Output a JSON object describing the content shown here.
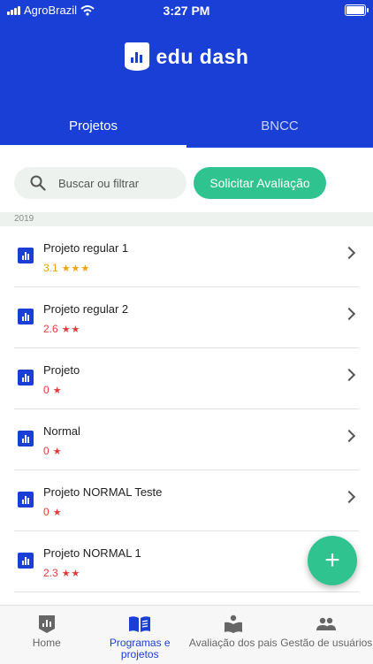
{
  "status_bar": {
    "carrier": "AgroBrazil",
    "time": "3:27 PM"
  },
  "header": {
    "logo_text": "edu dash"
  },
  "tabs": [
    {
      "label": "Projetos",
      "active": true
    },
    {
      "label": "BNCC",
      "active": false
    }
  ],
  "search": {
    "placeholder": "Buscar ou filtrar"
  },
  "actions": {
    "request_label": "Solicitar Avaliação"
  },
  "section": {
    "year": "2019"
  },
  "projects": [
    {
      "title": "Projeto regular 1",
      "score": "3.1",
      "stars": "★★★",
      "color": "#f2a20c"
    },
    {
      "title": "Projeto regular 2",
      "score": "2.6",
      "stars": "★★",
      "color": "#e23b3b"
    },
    {
      "title": "Projeto",
      "score": "0",
      "stars": "★",
      "color": "#e23b3b"
    },
    {
      "title": "Normal",
      "score": "0",
      "stars": "★",
      "color": "#e23b3b"
    },
    {
      "title": "Projeto NORMAL Teste",
      "score": "0",
      "stars": "★",
      "color": "#e23b3b"
    },
    {
      "title": "Projeto NORMAL 1",
      "score": "2.3",
      "stars": "★★",
      "color": "#e23b3b"
    }
  ],
  "fab": {
    "label": "+"
  },
  "bottom_nav": [
    {
      "label": "Home",
      "active": false
    },
    {
      "label": "Programas e projetos",
      "active": true
    },
    {
      "label": "Avaliação dos pais",
      "active": false
    },
    {
      "label": "Gestão de usuários",
      "active": false
    }
  ],
  "colors": {
    "primary": "#1a3fd6",
    "accent": "#2fc48f",
    "star_orange": "#f2a20c",
    "star_red": "#e23b3b"
  }
}
